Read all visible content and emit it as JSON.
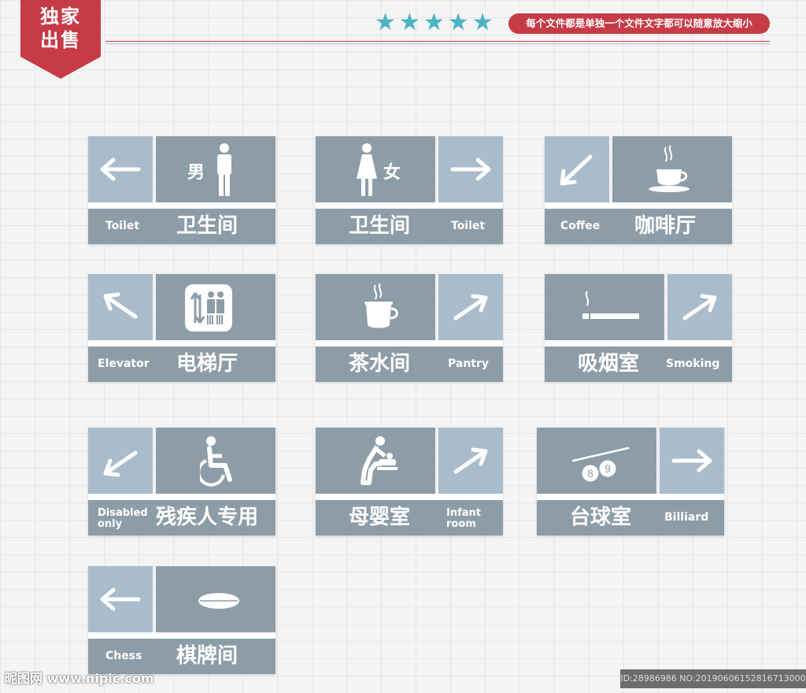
{
  "header": {
    "badge_line1": "独家",
    "badge_line2": "出售",
    "stars": 5,
    "slogan": "每个文件都是单独一个文件文字都可以随意放大缩小"
  },
  "signs": [
    {
      "cn": "卫生间",
      "en": "Toilet",
      "direction": "left",
      "icon": "male-person-icon",
      "icon_label": "男"
    },
    {
      "cn": "卫生间",
      "en": "Toilet",
      "direction": "right",
      "icon": "female-person-icon",
      "icon_label": "女"
    },
    {
      "cn": "咖啡厅",
      "en": "Coffee",
      "direction": "down-left",
      "icon": "coffee-cup-icon"
    },
    {
      "cn": "电梯厅",
      "en": "Elevator",
      "direction": "up-left",
      "icon": "elevator-icon"
    },
    {
      "cn": "茶水间",
      "en": "Pantry",
      "direction": "up-right",
      "icon": "teapot-icon"
    },
    {
      "cn": "吸烟室",
      "en": "Smoking",
      "direction": "up-right",
      "icon": "cigarette-icon"
    },
    {
      "cn": "残疾人专用",
      "en_line1": "Disabled",
      "en_line2": "only",
      "direction": "down-left",
      "icon": "wheelchair-icon"
    },
    {
      "cn": "母婴室",
      "en_line1": "Infant",
      "en_line2": "room",
      "direction": "up-right",
      "icon": "baby-changing-icon"
    },
    {
      "cn": "台球室",
      "en": "Billiard",
      "direction": "right",
      "icon": "billiard-icon",
      "ball_1": "8",
      "ball_2": "9"
    },
    {
      "cn": "棋牌间",
      "en": "Chess",
      "direction": "left",
      "icon": "chess-piece-icon"
    }
  ],
  "watermark": {
    "site": "昵图网 www.nipic.com",
    "id": "ID:28986986 NO:20190606152816713000"
  },
  "colors": {
    "light": "#a9bccb",
    "dark": "#8d9da8",
    "accent": "#c73b46",
    "star": "#4bb3c3"
  }
}
